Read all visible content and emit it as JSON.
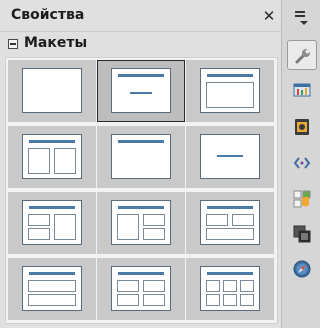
{
  "panel": {
    "title": "Свойства",
    "close_glyph": "✕",
    "section_title": "Макеты"
  },
  "layouts": [
    {
      "name": "blank-slide"
    },
    {
      "name": "title-slide",
      "selected": true
    },
    {
      "name": "title-content"
    },
    {
      "name": "title-two-content"
    },
    {
      "name": "title-only"
    },
    {
      "name": "centered-text"
    },
    {
      "name": "title-two-content-and-content"
    },
    {
      "name": "title-content-and-two-content"
    },
    {
      "name": "title-two-content-over-content"
    },
    {
      "name": "title-content-over-content"
    },
    {
      "name": "title-four-content"
    },
    {
      "name": "title-six-content"
    }
  ],
  "sidebar": {
    "buttons": [
      {
        "icon": "wrench-icon",
        "active": true
      },
      {
        "icon": "slide-transition-icon"
      },
      {
        "icon": "animation-icon"
      },
      {
        "icon": "master-slides-icon"
      },
      {
        "icon": "styles-icon"
      },
      {
        "icon": "gallery-icon"
      },
      {
        "icon": "navigator-icon"
      }
    ]
  }
}
